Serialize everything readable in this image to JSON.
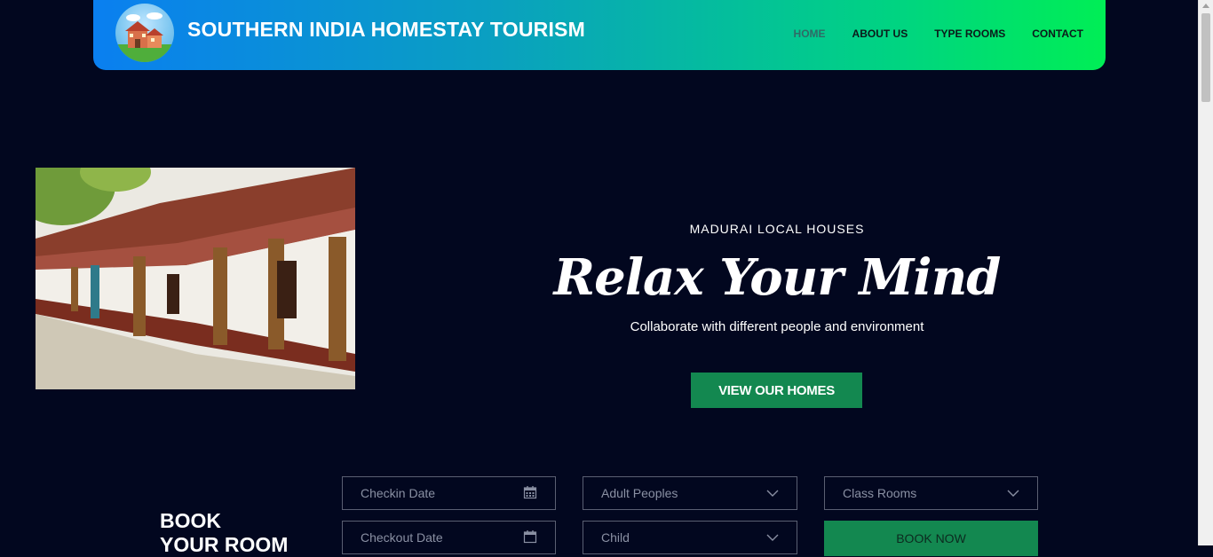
{
  "brand": {
    "title": "SOUTHERN INDIA HOMESTAY TOURISM",
    "logo_icon": "house-logo-icon"
  },
  "nav": {
    "items": [
      "HOME",
      "ABOUT US",
      "TYPE ROOMS",
      "CONTACT"
    ],
    "active": "HOME"
  },
  "hero": {
    "kicker": "MADURAI LOCAL HOUSES",
    "headline": "Relax Your Mind",
    "subtitle": "Collaborate with different people and environment",
    "cta": "VIEW OUR HOMES"
  },
  "booking": {
    "title_line1": "BOOK",
    "title_line2": "YOUR ROOM",
    "checkin_placeholder": "Checkin Date",
    "checkout_placeholder": "Checkout Date",
    "adults_placeholder": "Adult Peoples",
    "child_placeholder": "Child",
    "class_placeholder": "Class Rooms",
    "submit": "BOOK NOW"
  },
  "colors": {
    "accent": "#138850",
    "background": "#02071f"
  }
}
